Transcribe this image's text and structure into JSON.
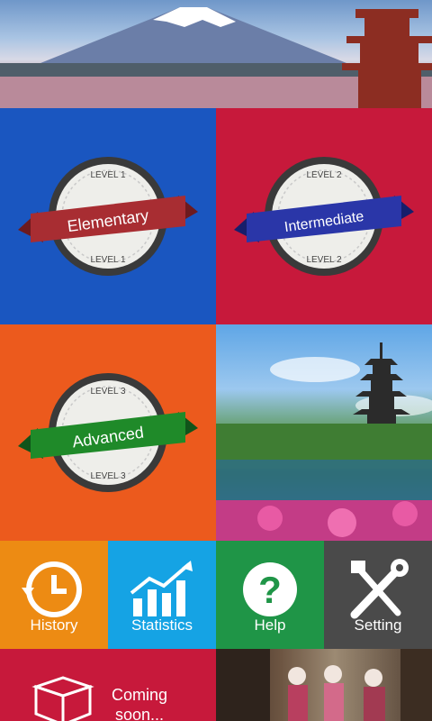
{
  "levels": [
    {
      "top": "LEVEL 1",
      "bottom": "LEVEL 1",
      "name": "Elementary",
      "ribbon": "#a82d32",
      "ribbon_dark": "#6d1a1e"
    },
    {
      "top": "LEVEL 2",
      "bottom": "LEVEL 2",
      "name": "Intermediate",
      "ribbon": "#2a36a8",
      "ribbon_dark": "#171e6b"
    },
    {
      "top": "LEVEL 3",
      "bottom": "LEVEL 3",
      "name": "Advanced",
      "ribbon": "#1f8a29",
      "ribbon_dark": "#10541a"
    }
  ],
  "menu": {
    "history": "History",
    "statistics": "Statistics",
    "help": "Help",
    "setting": "Setting",
    "coming_soon": "Coming soon..."
  },
  "icons": {
    "history": "history-icon",
    "statistics": "statistics-icon",
    "help": "help-icon",
    "setting": "setting-icon",
    "coming_soon": "box-icon"
  },
  "colors": {
    "elementary_bg": "#1a56c0",
    "intermediate_bg": "#c7193b",
    "advanced_bg": "#ec5a1d",
    "history_bg": "#ed8b13",
    "statistics_bg": "#15a3e4",
    "help_bg": "#1f9547",
    "setting_bg": "#4a4a4a"
  }
}
